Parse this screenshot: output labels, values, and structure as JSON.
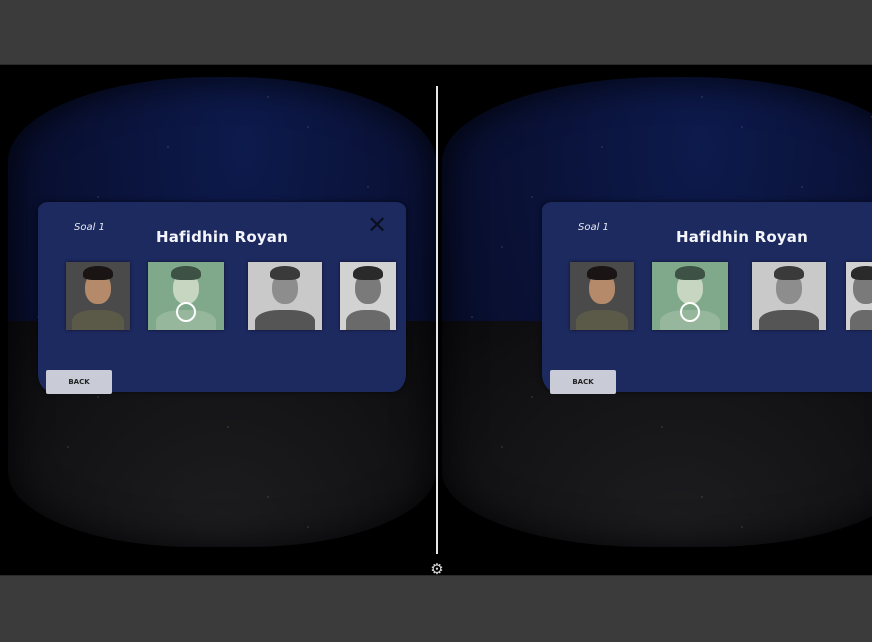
{
  "scene": {
    "question_label": "Soal 1",
    "target_name": "Hafidhin Royan",
    "back_label": "BACK",
    "close_icon": "close-icon",
    "settings_icon": "gear-icon",
    "gaze_reticle": "gaze-reticle",
    "photos": [
      {
        "name": "portrait-1",
        "tone": "color"
      },
      {
        "name": "portrait-2",
        "tone": "green-highlight"
      },
      {
        "name": "portrait-3",
        "tone": "grayscale"
      },
      {
        "name": "portrait-4",
        "tone": "grayscale"
      }
    ],
    "colors": {
      "panel": "#1d2a60",
      "sky": "#0a1238",
      "highlight": "#7fa98a"
    }
  }
}
